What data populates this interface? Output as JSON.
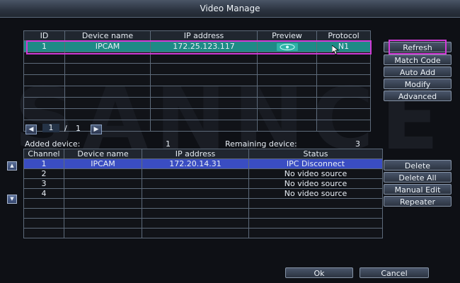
{
  "window": {
    "title": "Video Manage"
  },
  "top_table": {
    "headers": [
      "ID",
      "Device name",
      "IP address",
      "Preview",
      "Protocol"
    ],
    "rows": [
      {
        "id": "1",
        "device_name": "IPCAM",
        "ip": "172.25.123.117",
        "preview_icon": "eye-icon",
        "protocol": "N1"
      }
    ],
    "empty_rows": 7
  },
  "right_buttons_top": {
    "refresh": "Refresh",
    "match_code": "Match Code",
    "auto_add": "Auto Add",
    "modify": "Modify",
    "advanced": "Advanced"
  },
  "pagination": {
    "current": "1",
    "separator": "/",
    "total": "1",
    "prev_icon": "chevron-left-icon",
    "next_icon": "chevron-right-icon"
  },
  "summary": {
    "added_label": "Added device:",
    "added_value": "1",
    "remaining_label": "Remaining device:",
    "remaining_value": "3"
  },
  "bottom_table": {
    "headers": [
      "Channel",
      "Device name",
      "IP address",
      "Status"
    ],
    "rows": [
      {
        "channel": "1",
        "device_name": "IPCAM",
        "ip": "172.20.14.31",
        "status": "IPC Disconnect"
      },
      {
        "channel": "2",
        "device_name": "",
        "ip": "",
        "status": "No video source"
      },
      {
        "channel": "3",
        "device_name": "",
        "ip": "",
        "status": "No video source"
      },
      {
        "channel": "4",
        "device_name": "",
        "ip": "",
        "status": "No video source"
      }
    ],
    "empty_rows": 4,
    "up_icon": "arrow-up-icon",
    "down_icon": "arrow-down-icon"
  },
  "right_buttons_bottom": {
    "delete": "Delete",
    "delete_all": "Delete All",
    "manual_edit": "Manual Edit",
    "repeater": "Repeater"
  },
  "footer": {
    "ok": "Ok",
    "cancel": "Cancel"
  },
  "colors": {
    "selected_top": "#1f8a86",
    "selected_bottom": "#3a4dc2",
    "highlight": "#d03ad6"
  }
}
